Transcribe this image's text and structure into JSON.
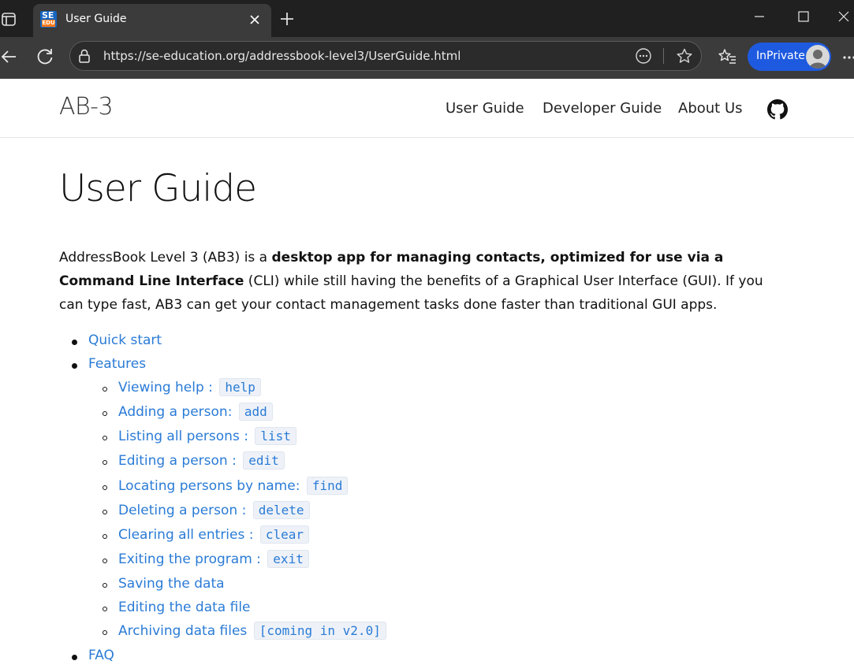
{
  "browser": {
    "tab_title": "User Guide",
    "favicon_text_top": "SE",
    "favicon_text_bottom": "EDU",
    "url": "https://se-education.org/addressbook-level3/UserGuide.html",
    "inprivate_label": "InPrivate",
    "colors": {
      "tabbar": "#202020",
      "toolbar": "#3b3b3b",
      "inprivate": "#1e5ae0"
    }
  },
  "site": {
    "brand": "AB-3",
    "nav": [
      "User Guide",
      "Developer Guide",
      "About Us"
    ]
  },
  "page": {
    "title": "User Guide",
    "intro": {
      "part1": "AddressBook Level 3 (AB3) is a ",
      "bold1": "desktop app for managing contacts, optimized for use via a",
      "bold2": "Command Line Interface",
      "part2": " (CLI) while still having the benefits of a Graphical User Interface (GUI). If you",
      "part3": "can type fast, AB3 can get your contact management tasks done faster than traditional GUI apps."
    },
    "toc": [
      {
        "label": "Quick start"
      },
      {
        "label": "Features"
      },
      {
        "label": "Viewing help :",
        "code": "help"
      },
      {
        "label": "Adding a person:",
        "code": "add"
      },
      {
        "label": "Listing all persons :",
        "code": "list"
      },
      {
        "label": "Editing a person :",
        "code": "edit"
      },
      {
        "label": "Locating persons by name:",
        "code": "find"
      },
      {
        "label": "Deleting a person :",
        "code": "delete"
      },
      {
        "label": "Clearing all entries :",
        "code": "clear"
      },
      {
        "label": "Exiting the program :",
        "code": "exit"
      },
      {
        "label": "Saving the data"
      },
      {
        "label": "Editing the data file"
      },
      {
        "label": "Archiving data files",
        "code": "[coming in v2.0]"
      },
      {
        "label": "FAQ"
      }
    ],
    "link_color": "#2a7bd6"
  }
}
